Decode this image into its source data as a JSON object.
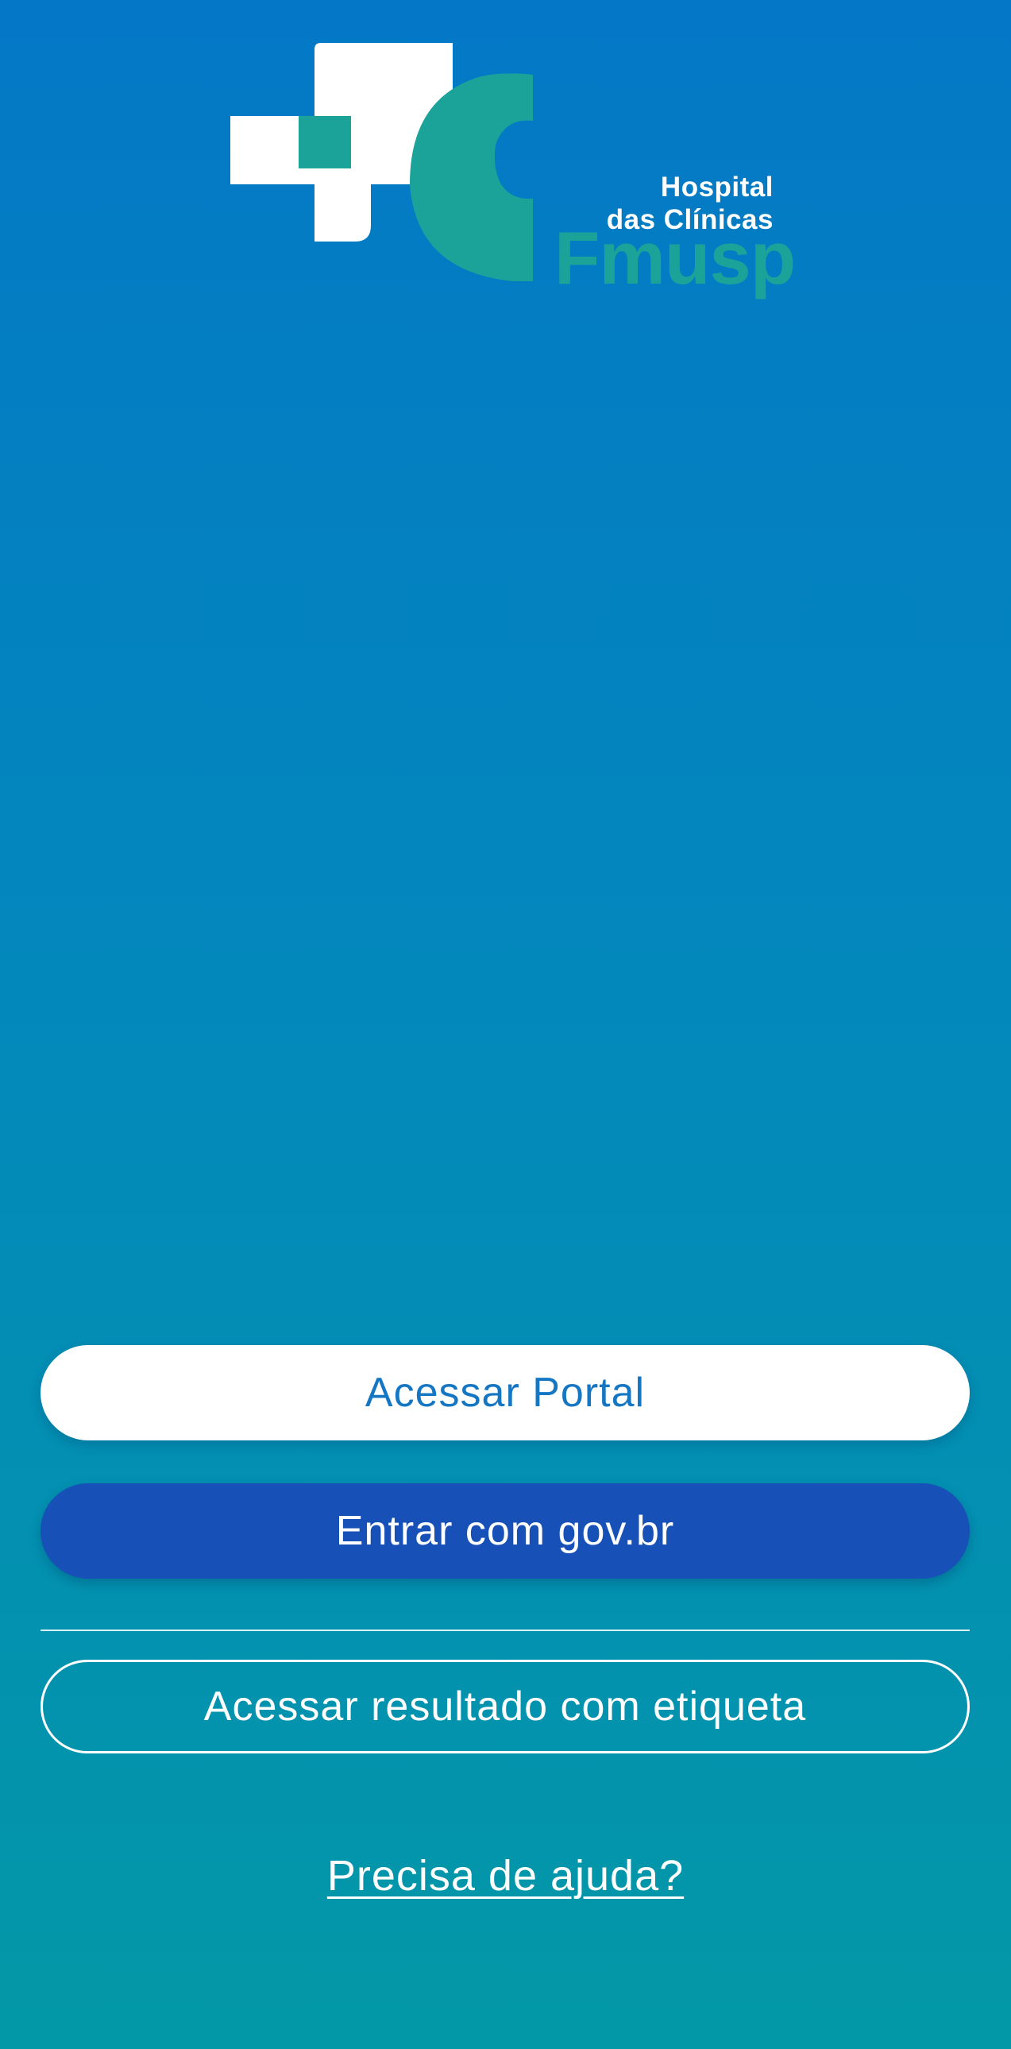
{
  "logo": {
    "line1": "Hospital",
    "line2": "das Clínicas",
    "line3": "Fmusp",
    "icon": "hc-fmusp-logo",
    "colors": {
      "white": "#ffffff",
      "teal": "#1ba39a"
    }
  },
  "actions": {
    "portal_label": "Acessar Portal",
    "govbr_label": "Entrar com gov.br",
    "label_result": "Acessar resultado com etiqueta",
    "help_label": "Precisa de ajuda?"
  },
  "colors": {
    "background_top": "#0478c6",
    "background_bottom": "#0398a7",
    "portal_button_bg": "#ffffff",
    "portal_button_text": "#1577c3",
    "govbr_button_bg": "#1751b8"
  }
}
